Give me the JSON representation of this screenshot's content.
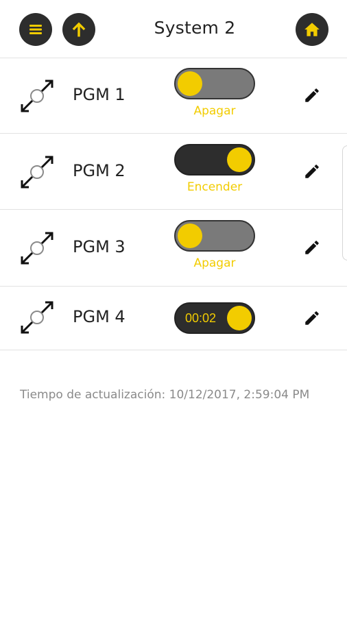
{
  "header": {
    "title": "System 2"
  },
  "pgms": [
    {
      "label": "PGM 1",
      "toggle_state": "off",
      "state_text": "Apagar"
    },
    {
      "label": "PGM 2",
      "toggle_state": "on",
      "state_text": "Encender"
    },
    {
      "label": "PGM 3",
      "toggle_state": "off",
      "state_text": "Apagar"
    },
    {
      "label": "PGM 4",
      "toggle_state": "on",
      "timer": "00:02"
    }
  ],
  "footer": {
    "update_text": "Tiempo de actualización: 10/12/2017, 2:59:04 PM"
  },
  "colors": {
    "accent": "#f2cc00",
    "dark": "#2d2d2d",
    "toggle_off": "#7a7a7a"
  },
  "icons": {
    "menu": "menu-icon",
    "up": "arrow-up-icon",
    "home": "home-icon",
    "pgm": "pgm-output-icon",
    "edit": "pencil-icon"
  }
}
